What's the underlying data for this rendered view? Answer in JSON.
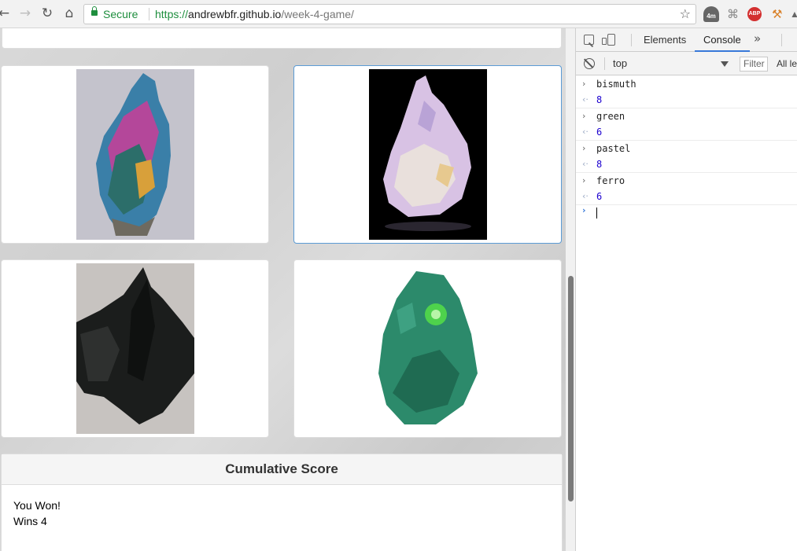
{
  "browser": {
    "secure_label": "Secure",
    "url_scheme": "https://",
    "url_host": "andrewbfr.github.io",
    "url_path": "/week-4-game/",
    "extensions": {
      "badge_4m": "4m",
      "abp": "ABP"
    }
  },
  "page": {
    "crystals": [
      {
        "name": "bismuth",
        "colors": [
          "#c4c3cc",
          "#3a7fa8",
          "#b4479a"
        ]
      },
      {
        "name": "pastel",
        "colors": [
          "#000000",
          "#d8c2e4",
          "#e9e0dc"
        ]
      },
      {
        "name": "ferro",
        "colors": [
          "#c7c3c0",
          "#1b1d1c",
          "#2e302f"
        ]
      },
      {
        "name": "green",
        "colors": [
          "#ffffff",
          "#2c8a6b",
          "#4ed24c"
        ]
      }
    ],
    "score": {
      "heading": "Cumulative Score",
      "status": "You Won!",
      "wins": "Wins 4"
    }
  },
  "devtools": {
    "tabs": [
      "Elements",
      "Console"
    ],
    "active_tab": "Console",
    "context": "top",
    "filter_placeholder": "Filter",
    "levels": "All levels",
    "console_entries": [
      {
        "input": "bismuth",
        "output": "8"
      },
      {
        "input": "green",
        "output": "6"
      },
      {
        "input": "pastel",
        "output": "8"
      },
      {
        "input": "ferro",
        "output": "6"
      }
    ]
  }
}
